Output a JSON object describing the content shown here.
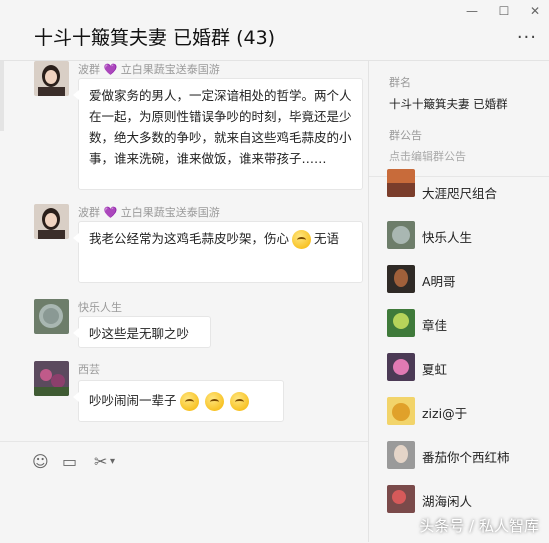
{
  "window": {
    "title": "十斗十簸箕夫妻 已婚群 (43)",
    "controls": [
      "—",
      "☐",
      "✕"
    ],
    "more": "···"
  },
  "messages": [
    {
      "sender_name": "波群",
      "heart": "💜",
      "sender_note": "立白果蔬宝送泰国游",
      "text": "爱做家务的男人，一定深谙相处的哲学。两个人在一起，为原则性错误争吵的时刻，毕竟还是少数，绝大多数的争吵，就来自这些鸡毛蒜皮的小事，谁来洗碗，谁来做饭，谁来带孩子……"
    },
    {
      "sender_name": "波群",
      "heart": "💜",
      "sender_note": "立白果蔬宝送泰国游",
      "text_a": "我老公经常为这鸡毛蒜皮吵架，伤心",
      "text_b": "无语"
    },
    {
      "sender_name": "快乐人生",
      "text": "吵这些是无聊之吵"
    },
    {
      "sender_name": "西芸",
      "text": "吵吵闹闹一辈子"
    }
  ],
  "toolbar": {
    "emoji": "☺",
    "folder": "▭",
    "scissors": "✂",
    "caret": "▾"
  },
  "sidebar": {
    "group_name_label": "群名",
    "group_name": "十斗十簸箕夫妻 已婚群",
    "notice_label": "群公告",
    "notice_prompt": "点击编辑群公告",
    "members": [
      "大涯咫尺组合",
      "快乐人生",
      "A明哥",
      "章佳",
      "夏虹",
      "zizi@于",
      "番茄你个西红柿",
      "湖海闲人"
    ]
  },
  "watermark": "头条号 / 私人智库"
}
